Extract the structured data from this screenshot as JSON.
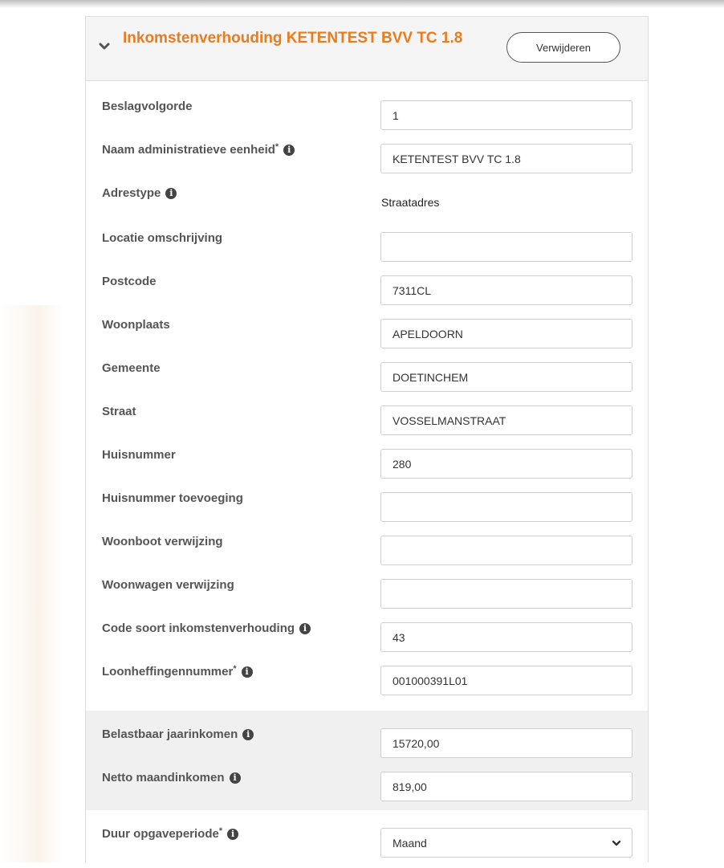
{
  "panel": {
    "title": "Inkomstenverhouding KETENTEST BVV TC 1.8",
    "remove_label": "Verwijderen",
    "accent": "#e87c1e"
  },
  "fields": [
    {
      "label": "Beslagvolgorde",
      "value": "1",
      "required": false,
      "info": false,
      "kind": "input"
    },
    {
      "label": "Naam administratieve eenheid",
      "value": "KETENTEST BVV TC 1.8",
      "required": true,
      "info": true,
      "kind": "input"
    },
    {
      "label": "Adrestype",
      "value": "Straatadres",
      "required": false,
      "info": true,
      "kind": "static"
    },
    {
      "label": "Locatie omschrijving",
      "value": "",
      "required": false,
      "info": false,
      "kind": "input"
    },
    {
      "label": "Postcode",
      "value": "7311CL",
      "required": false,
      "info": false,
      "kind": "input"
    },
    {
      "label": "Woonplaats",
      "value": "APELDOORN",
      "required": false,
      "info": false,
      "kind": "input"
    },
    {
      "label": "Gemeente",
      "value": "DOETINCHEM",
      "required": false,
      "info": false,
      "kind": "input"
    },
    {
      "label": "Straat",
      "value": "VOSSELMANSTRAAT",
      "required": false,
      "info": false,
      "kind": "input"
    },
    {
      "label": "Huisnummer",
      "value": "280",
      "required": false,
      "info": false,
      "kind": "input"
    },
    {
      "label": "Huisnummer toevoeging",
      "value": "",
      "required": false,
      "info": false,
      "kind": "input"
    },
    {
      "label": "Woonboot verwijzing",
      "value": "",
      "required": false,
      "info": false,
      "kind": "input"
    },
    {
      "label": "Woonwagen verwijzing",
      "value": "",
      "required": false,
      "info": false,
      "kind": "input"
    },
    {
      "label": "Code soort inkomstenverhouding",
      "value": "43",
      "required": false,
      "info": true,
      "kind": "input"
    },
    {
      "label": "Loonheffingennummer",
      "value": "001000391L01",
      "required": true,
      "info": true,
      "kind": "input"
    }
  ],
  "income": [
    {
      "label": "Belastbaar jaarinkomen",
      "value": "15720,00",
      "info": true
    },
    {
      "label": "Netto maandinkomen",
      "value": "819,00",
      "info": true
    }
  ],
  "period": {
    "label": "Duur opgaveperiode",
    "required": true,
    "selected": "Maand"
  },
  "required_marker": "*",
  "info_glyph": "i"
}
